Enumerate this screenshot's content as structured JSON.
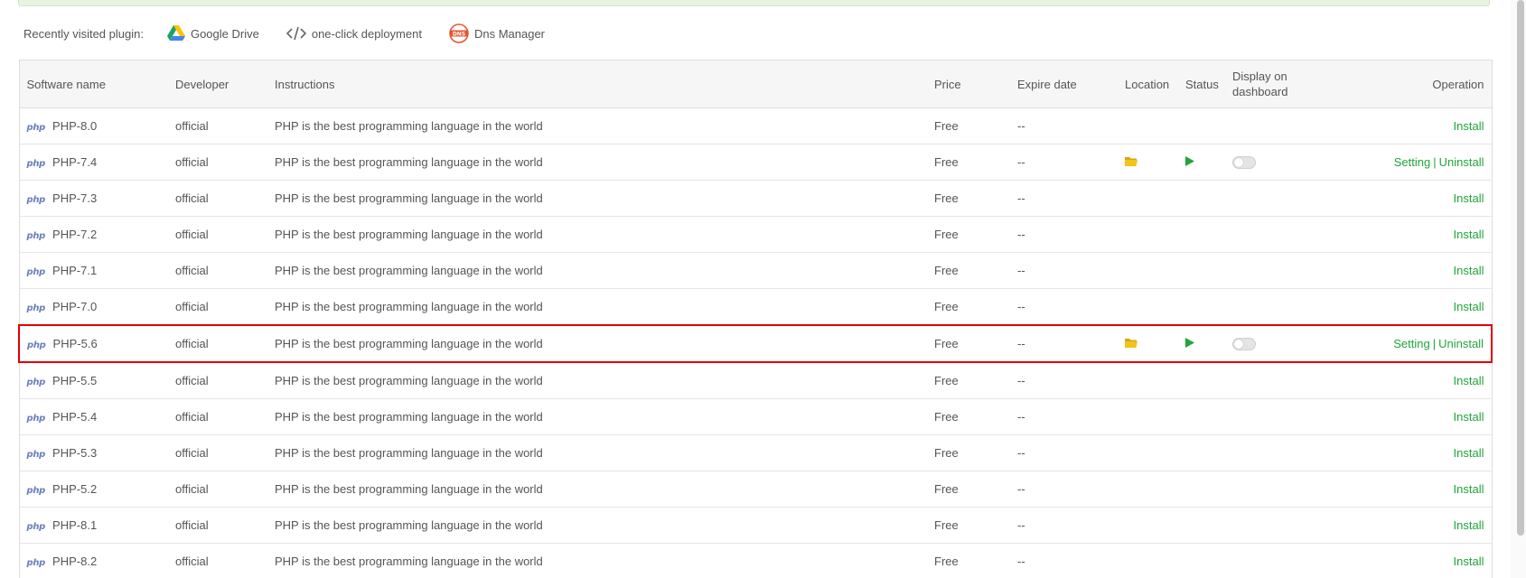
{
  "recent": {
    "label": "Recently visited plugin:",
    "plugins": [
      {
        "name": "Google Drive",
        "icon": "google-drive-icon"
      },
      {
        "name": "one-click deployment",
        "icon": "code-icon"
      },
      {
        "name": "Dns Manager",
        "icon": "dns-icon"
      }
    ]
  },
  "table": {
    "headers": {
      "name": "Software name",
      "developer": "Developer",
      "instructions": "Instructions",
      "price": "Price",
      "expire": "Expire date",
      "location": "Location",
      "status": "Status",
      "display": "Display on dashboard",
      "operation": "Operation"
    },
    "rows": [
      {
        "name": "PHP-8.0",
        "developer": "official",
        "instructions": "PHP is the best programming language in the world",
        "price": "Free",
        "expire": "--",
        "installed": false,
        "op_install": "Install"
      },
      {
        "name": "PHP-7.4",
        "developer": "official",
        "instructions": "PHP is the best programming language in the world",
        "price": "Free",
        "expire": "--",
        "installed": true,
        "op_setting": "Setting",
        "op_sep": "|",
        "op_uninstall": "Uninstall",
        "dashboard": false
      },
      {
        "name": "PHP-7.3",
        "developer": "official",
        "instructions": "PHP is the best programming language in the world",
        "price": "Free",
        "expire": "--",
        "installed": false,
        "op_install": "Install"
      },
      {
        "name": "PHP-7.2",
        "developer": "official",
        "instructions": "PHP is the best programming language in the world",
        "price": "Free",
        "expire": "--",
        "installed": false,
        "op_install": "Install"
      },
      {
        "name": "PHP-7.1",
        "developer": "official",
        "instructions": "PHP is the best programming language in the world",
        "price": "Free",
        "expire": "--",
        "installed": false,
        "op_install": "Install"
      },
      {
        "name": "PHP-7.0",
        "developer": "official",
        "instructions": "PHP is the best programming language in the world",
        "price": "Free",
        "expire": "--",
        "installed": false,
        "op_install": "Install"
      },
      {
        "name": "PHP-5.6",
        "developer": "official",
        "instructions": "PHP is the best programming language in the world",
        "price": "Free",
        "expire": "--",
        "installed": true,
        "op_setting": "Setting",
        "op_sep": "|",
        "op_uninstall": "Uninstall",
        "dashboard": false,
        "highlighted": true
      },
      {
        "name": "PHP-5.5",
        "developer": "official",
        "instructions": "PHP is the best programming language in the world",
        "price": "Free",
        "expire": "--",
        "installed": false,
        "op_install": "Install"
      },
      {
        "name": "PHP-5.4",
        "developer": "official",
        "instructions": "PHP is the best programming language in the world",
        "price": "Free",
        "expire": "--",
        "installed": false,
        "op_install": "Install"
      },
      {
        "name": "PHP-5.3",
        "developer": "official",
        "instructions": "PHP is the best programming language in the world",
        "price": "Free",
        "expire": "--",
        "installed": false,
        "op_install": "Install"
      },
      {
        "name": "PHP-5.2",
        "developer": "official",
        "instructions": "PHP is the best programming language in the world",
        "price": "Free",
        "expire": "--",
        "installed": false,
        "op_install": "Install"
      },
      {
        "name": "PHP-8.1",
        "developer": "official",
        "instructions": "PHP is the best programming language in the world",
        "price": "Free",
        "expire": "--",
        "installed": false,
        "op_install": "Install"
      },
      {
        "name": "PHP-8.2",
        "developer": "official",
        "instructions": "PHP is the best programming language in the world",
        "price": "Free",
        "expire": "--",
        "installed": false,
        "op_install": "Install"
      }
    ]
  },
  "badge": {
    "php_label": "php"
  },
  "colors": {
    "accent": "#20a53a",
    "highlight": "#e20000",
    "folder": "#f0c419",
    "php": "#6b7fbd"
  }
}
